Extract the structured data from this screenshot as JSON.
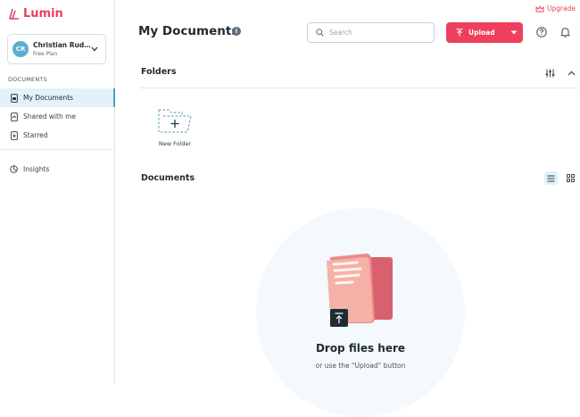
{
  "brand": {
    "name": "Lumin",
    "color": "#e8405a"
  },
  "account": {
    "initials": "CR",
    "name": "Christian Rude...",
    "plan": "Free Plan"
  },
  "sidebar": {
    "section_title": "DOCUMENTS",
    "items": [
      {
        "label": "My Documents",
        "icon": "document-icon",
        "active": true
      },
      {
        "label": "Shared with me",
        "icon": "shared-document-icon",
        "active": false
      },
      {
        "label": "Starred",
        "icon": "star-document-icon",
        "active": false
      }
    ],
    "insights_label": "Insights"
  },
  "header": {
    "title": "My Documents",
    "info": "i",
    "search_placeholder": "Search",
    "upload_label": "Upload",
    "upgrade_label": "Upgrade"
  },
  "folders": {
    "title": "Folders",
    "new_folder_label": "New Folder"
  },
  "documents": {
    "title": "Documents",
    "view_mode": "list",
    "empty_title": "Drop files here",
    "empty_subtitle": "or use the \"Upload\" button"
  },
  "colors": {
    "accent": "#ee3f5c",
    "active_nav_bg": "#e3f2f8",
    "teal": "#4b9fc0"
  }
}
